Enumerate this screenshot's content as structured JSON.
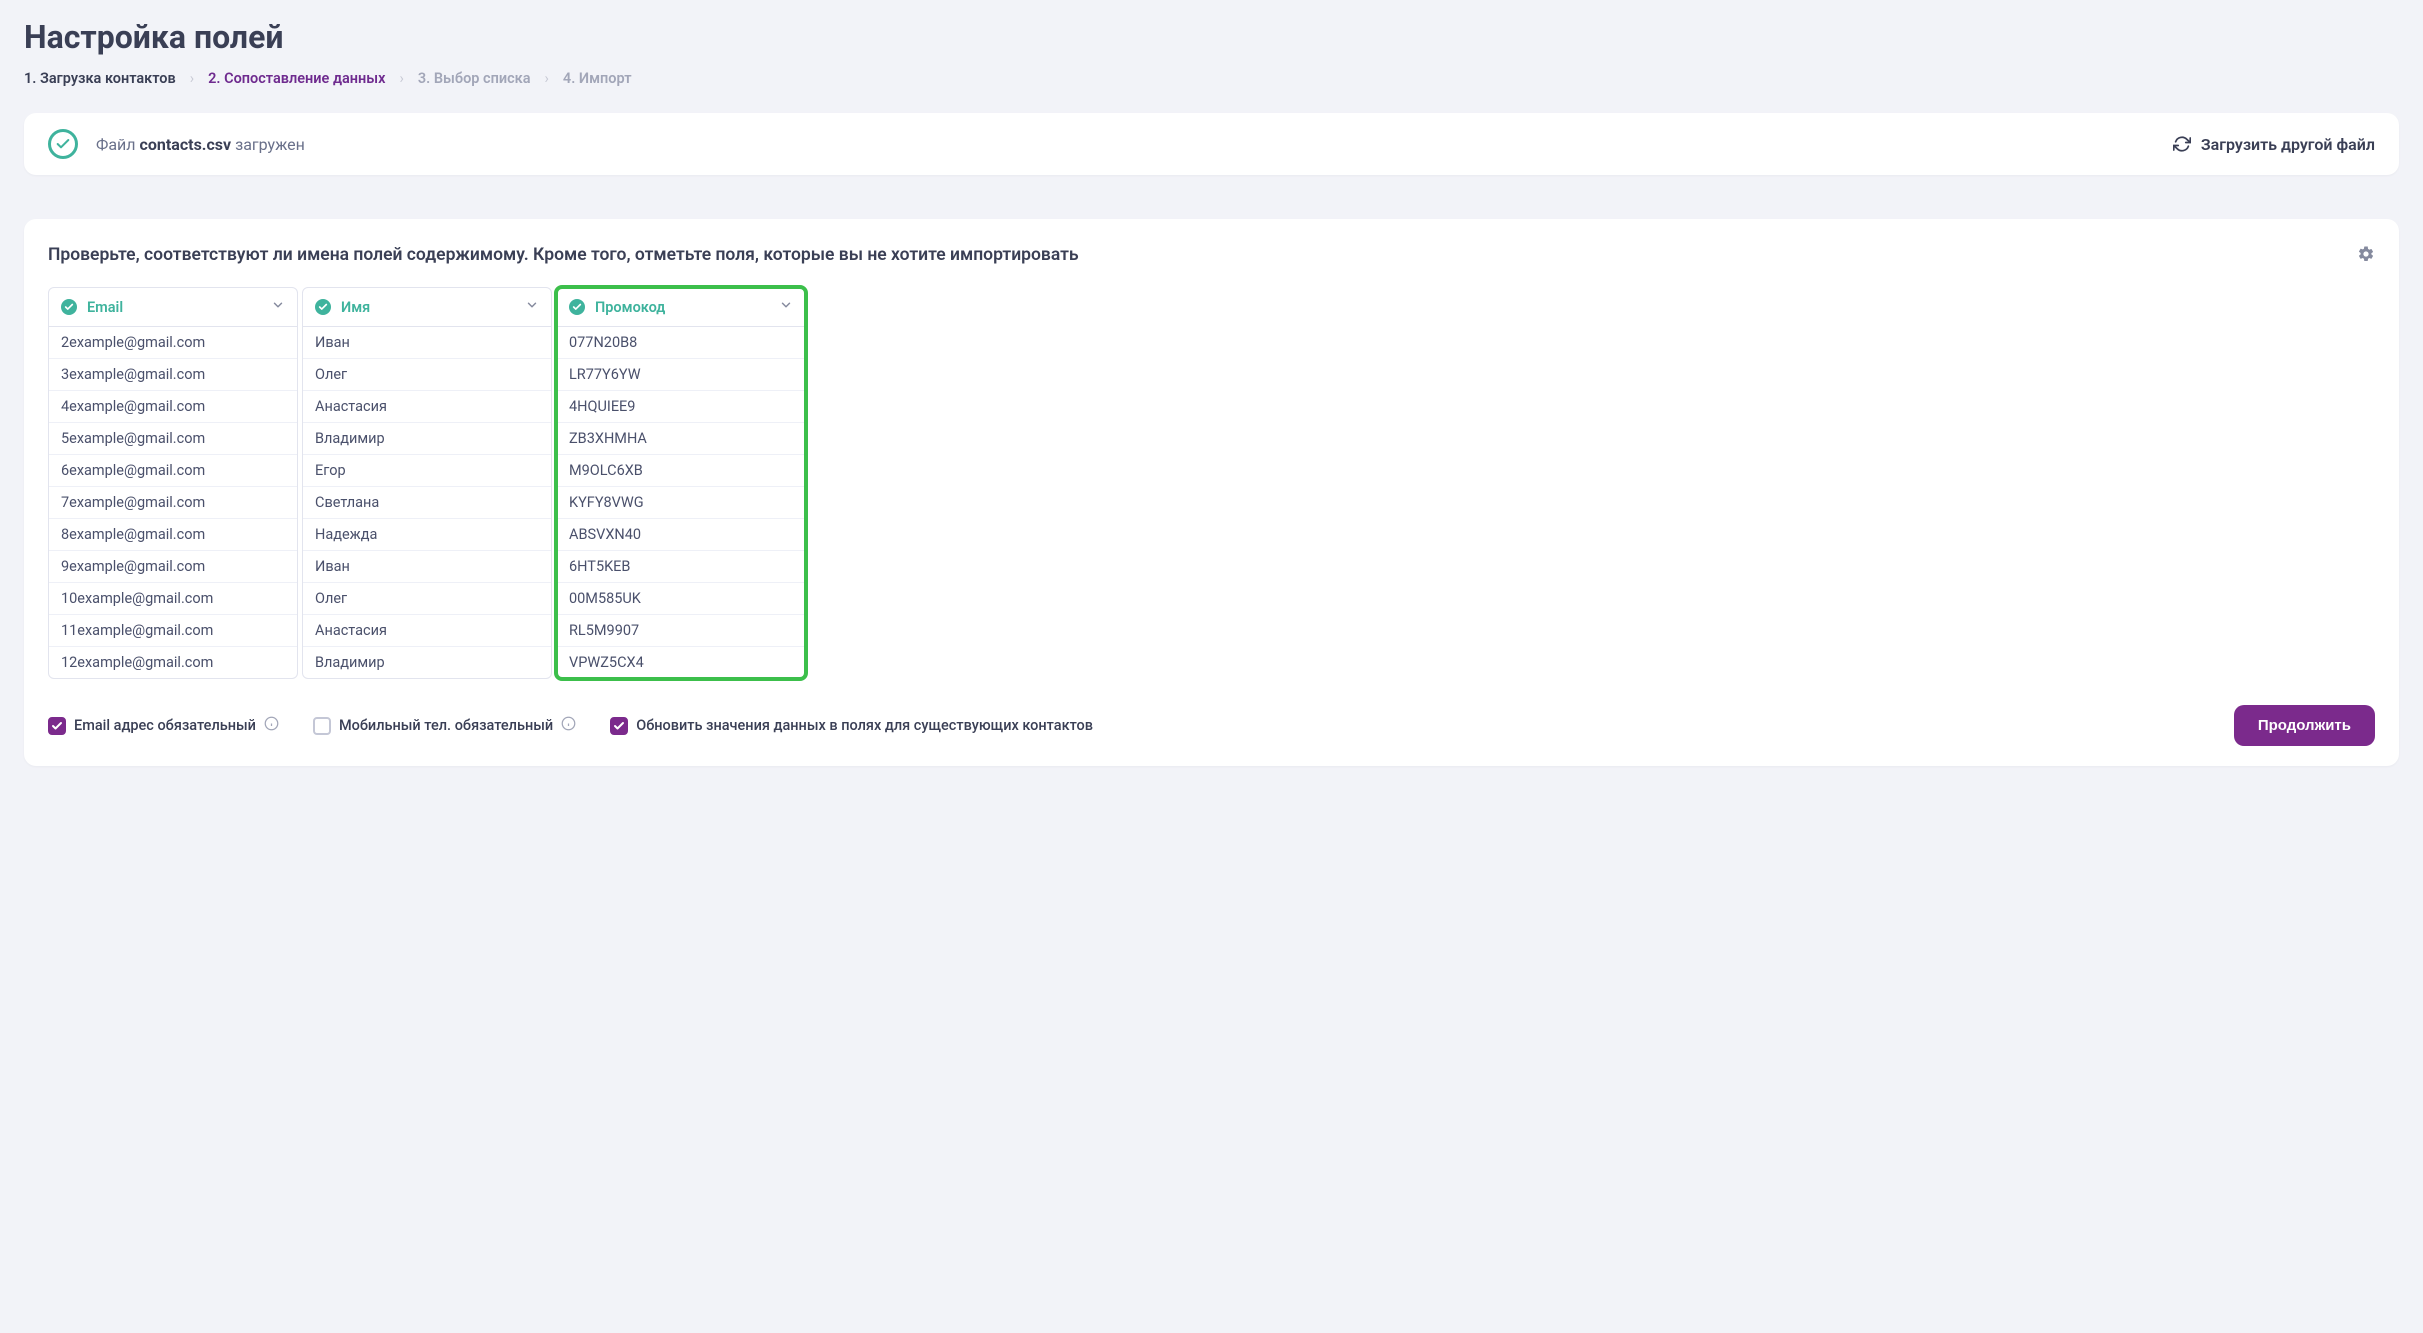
{
  "page_title": "Настройка полей",
  "breadcrumbs": [
    {
      "label": "1. Загрузка контактов",
      "state": "done"
    },
    {
      "label": "2. Сопоставление данных",
      "state": "active"
    },
    {
      "label": "3. Выбор списка",
      "state": "future"
    },
    {
      "label": "4. Импорт",
      "state": "future"
    }
  ],
  "file_banner": {
    "prefix": "Файл",
    "filename": "contacts.csv",
    "suffix": "загружен",
    "reload_label": "Загрузить другой файл"
  },
  "mapping": {
    "instruction": "Проверьте, соответствуют ли имена полей содержимому. Кроме того, отметьте поля, которые вы не хотите импортировать",
    "columns": [
      {
        "label": "Email",
        "highlighted": false
      },
      {
        "label": "Имя",
        "highlighted": false
      },
      {
        "label": "Промокод",
        "highlighted": true
      }
    ],
    "rows": [
      {
        "email": "2example@gmail.com",
        "name": "Иван",
        "promo": "077N20B8"
      },
      {
        "email": "3example@gmail.com",
        "name": "Олег",
        "promo": "LR77Y6YW"
      },
      {
        "email": "4example@gmail.com",
        "name": "Анастасия",
        "promo": "4HQUIEE9"
      },
      {
        "email": "5example@gmail.com",
        "name": "Владимир",
        "promo": "ZB3XHMHA"
      },
      {
        "email": "6example@gmail.com",
        "name": "Егор",
        "promo": "M9OLC6XB"
      },
      {
        "email": "7example@gmail.com",
        "name": "Светлана",
        "promo": "KYFY8VWG"
      },
      {
        "email": "8example@gmail.com",
        "name": "Надежда",
        "promo": "ABSVXN40"
      },
      {
        "email": "9example@gmail.com",
        "name": "Иван",
        "promo": "6HT5KEB"
      },
      {
        "email": "10example@gmail.com",
        "name": "Олег",
        "promo": "00M585UK"
      },
      {
        "email": "11example@gmail.com",
        "name": "Анастасия",
        "promo": "RL5M9907"
      },
      {
        "email": "12example@gmail.com",
        "name": "Владимир",
        "promo": "VPWZ5CX4"
      }
    ]
  },
  "footer": {
    "options": [
      {
        "label": "Email адрес обязательный",
        "checked": true,
        "info": true
      },
      {
        "label": "Мобильный тел. обязательный",
        "checked": false,
        "info": true
      },
      {
        "label": "Обновить значения данных в полях для существующих контактов",
        "checked": true,
        "info": false
      }
    ],
    "continue_label": "Продолжить"
  },
  "colors": {
    "accent_teal": "#3fb39d",
    "accent_purple": "#7b2a8c",
    "highlight_green": "#3cbf4b"
  }
}
